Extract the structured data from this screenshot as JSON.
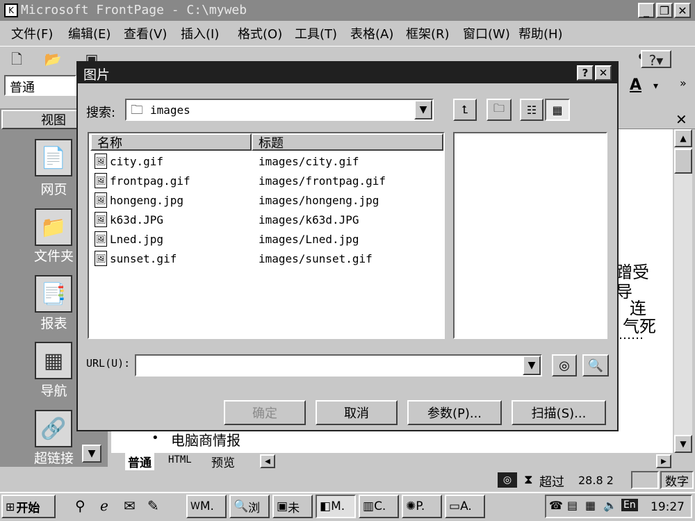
{
  "window": {
    "title": "Microsoft FrontPage - C:\\myweb"
  },
  "menu": [
    "文件(F)",
    "编辑(E)",
    "查看(V)",
    "插入(I)",
    "格式(O)",
    "工具(T)",
    "表格(A)",
    "框架(R)",
    "窗口(W)",
    "帮助(H)"
  ],
  "format": {
    "style": "普通"
  },
  "views": {
    "header": "视图",
    "items": [
      {
        "label": "网页",
        "icon": "page-icon"
      },
      {
        "label": "文件夹",
        "icon": "folder-icon"
      },
      {
        "label": "报表",
        "icon": "reports-icon"
      },
      {
        "label": "导航",
        "icon": "navigation-icon"
      },
      {
        "label": "超链接",
        "icon": "hyperlinks-icon"
      }
    ]
  },
  "document": {
    "fragments": [
      "蹭受",
      "导",
      "连",
      "气死",
      "……"
    ],
    "bullet_text": "电脑商情报",
    "tabs": [
      "普通",
      "HTML",
      "预览"
    ]
  },
  "dialog": {
    "title": "图片",
    "search_label": "搜索:",
    "folder": "images",
    "columns": [
      "名称",
      "标题"
    ],
    "files": [
      {
        "name": "city.gif",
        "title": "images/city.gif"
      },
      {
        "name": "frontpag.gif",
        "title": "images/frontpag.gif"
      },
      {
        "name": "hongeng.jpg",
        "title": "images/hongeng.jpg"
      },
      {
        "name": "k63d.JPG",
        "title": "images/k63d.JPG"
      },
      {
        "name": "Lned.jpg",
        "title": "images/Lned.jpg"
      },
      {
        "name": "sunset.gif",
        "title": "images/sunset.gif"
      }
    ],
    "url_label": "URL(U):",
    "url_value": "",
    "buttons": {
      "ok": "确定",
      "cancel": "取消",
      "params": "参数(P)...",
      "scan": "扫描(S)..."
    }
  },
  "status": {
    "time_label": "超过",
    "time_value": "28.8 2",
    "mode": "数字"
  },
  "taskbar": {
    "start": "开始",
    "tasks": [
      "M.",
      "浏",
      "未",
      "M.",
      "C.",
      "P.",
      "A."
    ],
    "lang": "En",
    "clock": "19:27"
  },
  "colors": {
    "titlebar": "#888888",
    "dialog_title": "#202020",
    "views_bg": "#909090"
  }
}
